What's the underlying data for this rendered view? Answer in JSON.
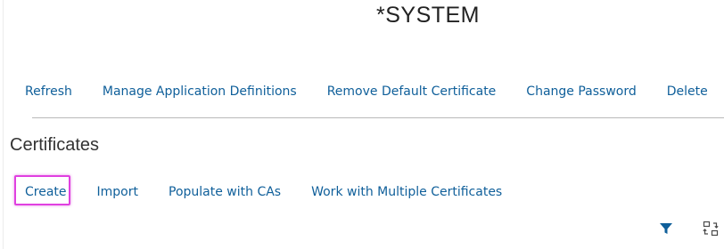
{
  "header": {
    "title": "*SYSTEM"
  },
  "toolbar": {
    "items": [
      {
        "label": "Refresh"
      },
      {
        "label": "Manage Application Definitions"
      },
      {
        "label": "Remove Default Certificate"
      },
      {
        "label": "Change Password"
      },
      {
        "label": "Delete"
      }
    ]
  },
  "certificates": {
    "title": "Certificates",
    "actions": [
      {
        "label": "Create",
        "highlighted": true
      },
      {
        "label": "Import"
      },
      {
        "label": "Populate with CAs"
      },
      {
        "label": "Work with Multiple Certificates"
      }
    ],
    "icons": [
      {
        "name": "filter-icon"
      },
      {
        "name": "column-settings-icon"
      }
    ]
  },
  "colors": {
    "link": "#0f5f9a",
    "highlight": "#e040e0",
    "divider": "#b9b9b9"
  }
}
